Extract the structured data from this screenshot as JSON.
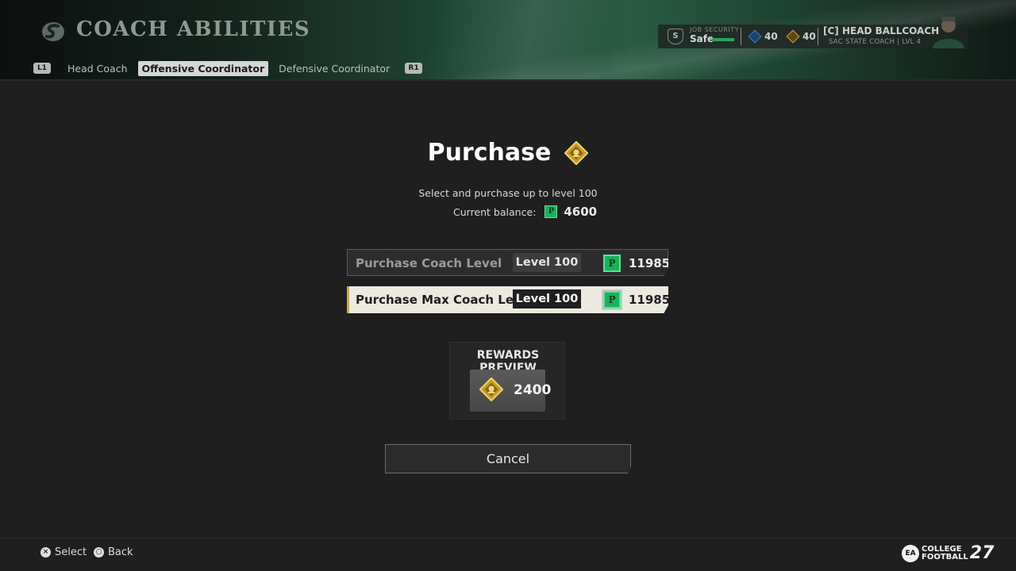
{
  "header": {
    "title": "COACH ABILITIES",
    "tabs": {
      "left_shoulder": "L1",
      "right_shoulder": "R1",
      "items": [
        "Head Coach",
        "Offensive Coordinator",
        "Defensive Coordinator"
      ],
      "active": "Offensive Coordinator"
    },
    "status": {
      "school_badge": "S",
      "job_security_label": "JOB SECURITY",
      "job_security_value": "Safe",
      "job_security_level": 1.0,
      "blue_count": "40",
      "gold_count": "40",
      "coach_name": "[C] HEAD BALLCOACH",
      "coach_subtitle": "SAC STATE COACH | LVL 4",
      "colors": {
        "blue": "#3f7fd0",
        "gold": "#d1a431",
        "green": "#2fa25f"
      }
    }
  },
  "purchase": {
    "title": "Purchase",
    "title_icon": "coach-ability-point-icon",
    "description": "Select and purchase up to level 100",
    "balance_label": "Current balance:",
    "currency_icon": "P",
    "balance_value": "4600",
    "options": [
      {
        "label": "Purchase Coach Level",
        "level": "Level 100",
        "currency": "P",
        "cost": "11985",
        "selected": false
      },
      {
        "label": "Purchase Max Coach Level",
        "level": "Level 100",
        "currency": "P",
        "cost": "11985",
        "selected": true
      }
    ],
    "rewards": {
      "title": "REWARDS PREVIEW",
      "amount": "2400",
      "icon": "coach-ability-point-icon"
    },
    "cancel_label": "Cancel"
  },
  "footer": {
    "select_glyph": "×",
    "select_label": "Select",
    "back_glyph": "○",
    "back_label": "Back",
    "brand_ea": "EA",
    "brand_line1": "COLLEGE",
    "brand_line2": "FOOTBALL",
    "brand_number": "27"
  }
}
